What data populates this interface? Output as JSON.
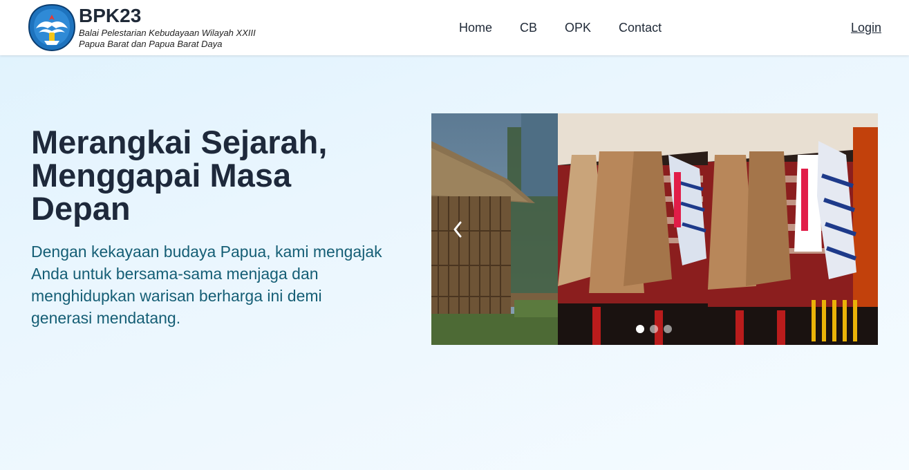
{
  "brand": {
    "title": "BPK23",
    "subtitle_line1": "Balai Pelestarian Kebudayaan Wilayah XXIII",
    "subtitle_line2": "Papua Barat dan Papua Barat Daya",
    "logo_icon": "tut-wuri-handayani-logo-icon"
  },
  "nav": {
    "items": [
      {
        "label": "Home"
      },
      {
        "label": "CB"
      },
      {
        "label": "OPK"
      },
      {
        "label": "Contact"
      }
    ],
    "login_label": "Login"
  },
  "hero": {
    "title": "Merangkai Sejarah, Menggapai Masa Depan",
    "description": "Dengan kekayaan budaya Papua, kami mengajak Anda untuk bersama-sama menjaga dan menghidupkan warisan berharga ini demi generasi mendatang."
  },
  "carousel": {
    "prev_icon": "chevron-left-icon",
    "next_icon": "chevron-right-icon",
    "slides": [
      {
        "name": "traditional-hut-image"
      },
      {
        "name": "noken-bags-image"
      },
      {
        "name": "noken-bags-image"
      }
    ],
    "active_index": 0
  },
  "colors": {
    "heading": "#1e293b",
    "description": "#155e75",
    "logo_blue": "#1e73be"
  }
}
